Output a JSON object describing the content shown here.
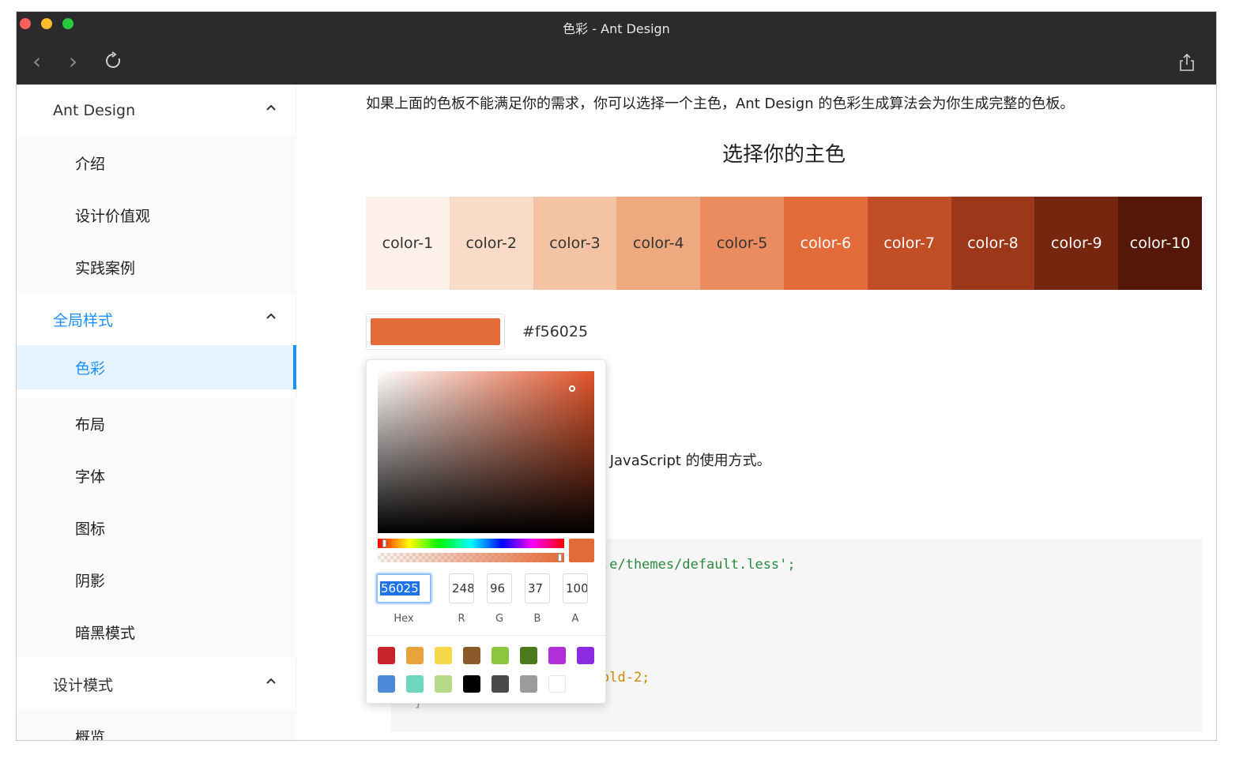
{
  "window": {
    "title": "色彩 - Ant Design"
  },
  "sidebar": {
    "groups": [
      {
        "label": "Ant Design",
        "items": [
          "介绍",
          "设计价值观",
          "实践案例"
        ]
      },
      {
        "label": "全局样式",
        "items": [
          "色彩",
          "布局",
          "字体",
          "图标",
          "阴影",
          "暗黑模式"
        ]
      },
      {
        "label": "设计模式",
        "items": [
          "概览"
        ]
      }
    ],
    "active_group": "全局样式",
    "selected_item": "色彩"
  },
  "content": {
    "intro": "如果上面的色板不能满足你的需求，你可以选择一个主色，Ant Design 的色彩生成算法会为你生成完整的色板。",
    "heading": "选择你的主色",
    "palette": [
      {
        "label": "color-1",
        "color": "#fdf1ea",
        "text_color": "#333333"
      },
      {
        "label": "color-2",
        "color": "#f9dbc8",
        "text_color": "#333333"
      },
      {
        "label": "color-3",
        "color": "#f4c3a3",
        "text_color": "#333333"
      },
      {
        "label": "color-4",
        "color": "#efa97e",
        "text_color": "#333333"
      },
      {
        "label": "color-5",
        "color": "#ea8c5f",
        "text_color": "#333333"
      },
      {
        "label": "color-6",
        "color": "#e36b3a",
        "text_color": "#ffffff"
      },
      {
        "label": "color-7",
        "color": "#c24e26",
        "text_color": "#ffffff"
      },
      {
        "label": "color-8",
        "color": "#9c3719",
        "text_color": "#ffffff"
      },
      {
        "label": "color-9",
        "color": "#76250f",
        "text_color": "#ffffff"
      },
      {
        "label": "color-10",
        "color": "#551707",
        "text_color": "#ffffff"
      }
    ],
    "selected_hex": "#f56025",
    "text_fragment": "l JavaScript 的使用方式。",
    "code_line_1": ".e/themes/default.less';",
    "code_line_2": "old-2;",
    "code_line_3": "}"
  },
  "color_picker": {
    "hex_value": "56025",
    "r": "248",
    "g": "96",
    "b": "37",
    "a": "100",
    "labels": {
      "hex": "Hex",
      "r": "R",
      "g": "G",
      "b": "B",
      "a": "A"
    },
    "presets": [
      "#c8232b",
      "#e8a33d",
      "#f5d94a",
      "#8b5a2b",
      "#8cc63f",
      "#4b7a1e",
      "#b02fd6",
      "#8a2be2",
      "#4a8ad6",
      "#6ed7bd",
      "#b5db8a",
      "#000000",
      "#4a4a4a",
      "#9b9b9b",
      "#ffffff"
    ]
  }
}
